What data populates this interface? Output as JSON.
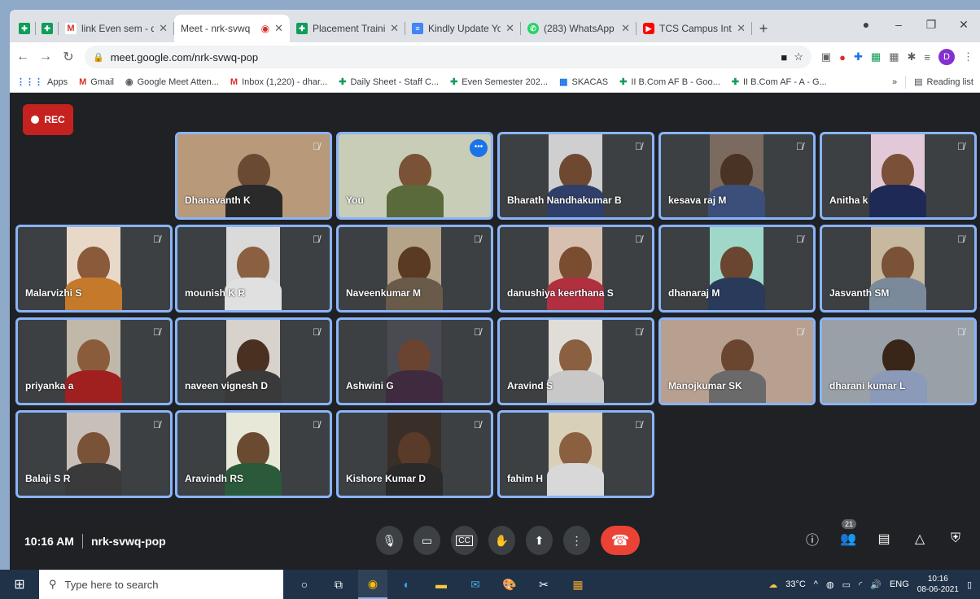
{
  "browser": {
    "tabs": [
      {
        "title": "",
        "favicon": "sheet-icon",
        "pinned": true
      },
      {
        "title": "",
        "favicon": "sheet-icon",
        "pinned": true
      },
      {
        "title": "link Even sem - dhar",
        "favicon": "gmail-icon"
      },
      {
        "title": "Meet - nrk-svwq",
        "favicon": "meet-icon",
        "active": true
      },
      {
        "title": "Placement Training",
        "favicon": "sheet-icon"
      },
      {
        "title": "Kindly Update Your",
        "favicon": "forms-icon"
      },
      {
        "title": "(283) WhatsApp",
        "favicon": "whatsapp-icon"
      },
      {
        "title": "TCS Campus Intervie",
        "favicon": "youtube-icon"
      }
    ],
    "url": "meet.google.com/nrk-svwq-pop",
    "profile_initial": "D",
    "bookmarks": [
      {
        "label": "Apps",
        "icon": "apps-icon"
      },
      {
        "label": "Gmail",
        "icon": "gmail-icon"
      },
      {
        "label": "Google Meet Atten...",
        "icon": "chrome-icon"
      },
      {
        "label": "Inbox (1,220) - dhar...",
        "icon": "gmail-icon"
      },
      {
        "label": "Daily Sheet - Staff C...",
        "icon": "sheet-icon"
      },
      {
        "label": "Even Semester 202...",
        "icon": "sheet-icon"
      },
      {
        "label": "SKACAS",
        "icon": "calendar-icon"
      },
      {
        "label": "II B.Com AF B - Goo...",
        "icon": "sheet-icon"
      },
      {
        "label": "II B.Com AF - A - G...",
        "icon": "sheet-icon"
      }
    ],
    "more_bookmarks": "»",
    "reading_list": "Reading list"
  },
  "meet": {
    "rec_label": "REC",
    "participants": [
      {
        "name": "Dhanavanth K",
        "muted": true,
        "bg": "#b89a7a",
        "skin": "#6b4a34",
        "shirt": "#2a2a2a"
      },
      {
        "name": "You",
        "muted": false,
        "bg": "#c8cdb8",
        "skin": "#7a5236",
        "shirt": "#5a6a3a",
        "self": true
      },
      {
        "name": "Bharath Nandhakumar B",
        "muted": true,
        "bg": "#cfcfcf",
        "skin": "#6e4830",
        "shirt": "#2f3f6a"
      },
      {
        "name": "kesava raj M",
        "muted": true,
        "bg": "#7a6a60",
        "skin": "#4a3224",
        "shirt": "#3b4f7a"
      },
      {
        "name": "Anitha k",
        "muted": true,
        "bg": "#e3c9d8",
        "skin": "#7a5038",
        "shirt": "#1e2a55"
      },
      {
        "name": "Malarvizhi S",
        "muted": true,
        "bg": "#e8d8c8",
        "skin": "#8a5a3a",
        "shirt": "#c47a2a"
      },
      {
        "name": "mounish K R",
        "muted": true,
        "bg": "#dadada",
        "skin": "#8a6040",
        "shirt": "#e0e0e0"
      },
      {
        "name": "Naveenkumar M",
        "muted": true,
        "bg": "#b5a48a",
        "skin": "#5a3a22",
        "shirt": "#6a5a4a"
      },
      {
        "name": "danushiya keerthana S",
        "muted": true,
        "bg": "#d8c0b0",
        "skin": "#7a4c30",
        "shirt": "#b03040"
      },
      {
        "name": "dhanaraj M",
        "muted": true,
        "bg": "#9fd8c8",
        "skin": "#6a4630",
        "shirt": "#2a3a5a"
      },
      {
        "name": "Jasvanth SM",
        "muted": true,
        "bg": "#c7b8a0",
        "skin": "#7a5238",
        "shirt": "#7a8a9a"
      },
      {
        "name": "priyanka a",
        "muted": true,
        "bg": "#c0b8a8",
        "skin": "#8a5c3c",
        "shirt": "#a02020"
      },
      {
        "name": "naveen vignesh D",
        "muted": true,
        "bg": "#d7d2cc",
        "skin": "#4a3020",
        "shirt": "#3a3a3a"
      },
      {
        "name": "Ashwini G",
        "muted": true,
        "bg": "#4a4a52",
        "skin": "#6a4430",
        "shirt": "#402a40"
      },
      {
        "name": "Aravind S",
        "muted": true,
        "bg": "#e0ddd8",
        "skin": "#8a6040",
        "shirt": "#c8c8c8"
      },
      {
        "name": "Manojkumar SK",
        "muted": true,
        "bg": "#b8a090",
        "skin": "#6a4630",
        "shirt": "#6a6a6a"
      },
      {
        "name": "dharani kumar L",
        "muted": true,
        "bg": "#9aa0a8",
        "skin": "#3a2618",
        "shirt": "#8a9ab8"
      },
      {
        "name": "Balaji S R",
        "muted": true,
        "bg": "#c8c0b8",
        "skin": "#7a5238",
        "shirt": "#3a3a3a"
      },
      {
        "name": "Aravindh RS",
        "muted": true,
        "bg": "#e8e8d8",
        "skin": "#6a4a30",
        "shirt": "#2a5a3a"
      },
      {
        "name": "Kishore Kumar D",
        "muted": true,
        "bg": "#3a2e28",
        "skin": "#5a3a28",
        "shirt": "#2a2a2a"
      },
      {
        "name": "fahim H",
        "muted": true,
        "bg": "#d8d0b8",
        "skin": "#8a6040",
        "shirt": "#d8d8d8"
      }
    ],
    "time": "10:16 AM",
    "meeting_code": "nrk-svwq-pop",
    "participant_count": "21"
  },
  "taskbar": {
    "search_placeholder": "Type here to search",
    "weather": "33°C",
    "language": "ENG",
    "clock_time": "10:16",
    "clock_date": "08-06-2021"
  }
}
